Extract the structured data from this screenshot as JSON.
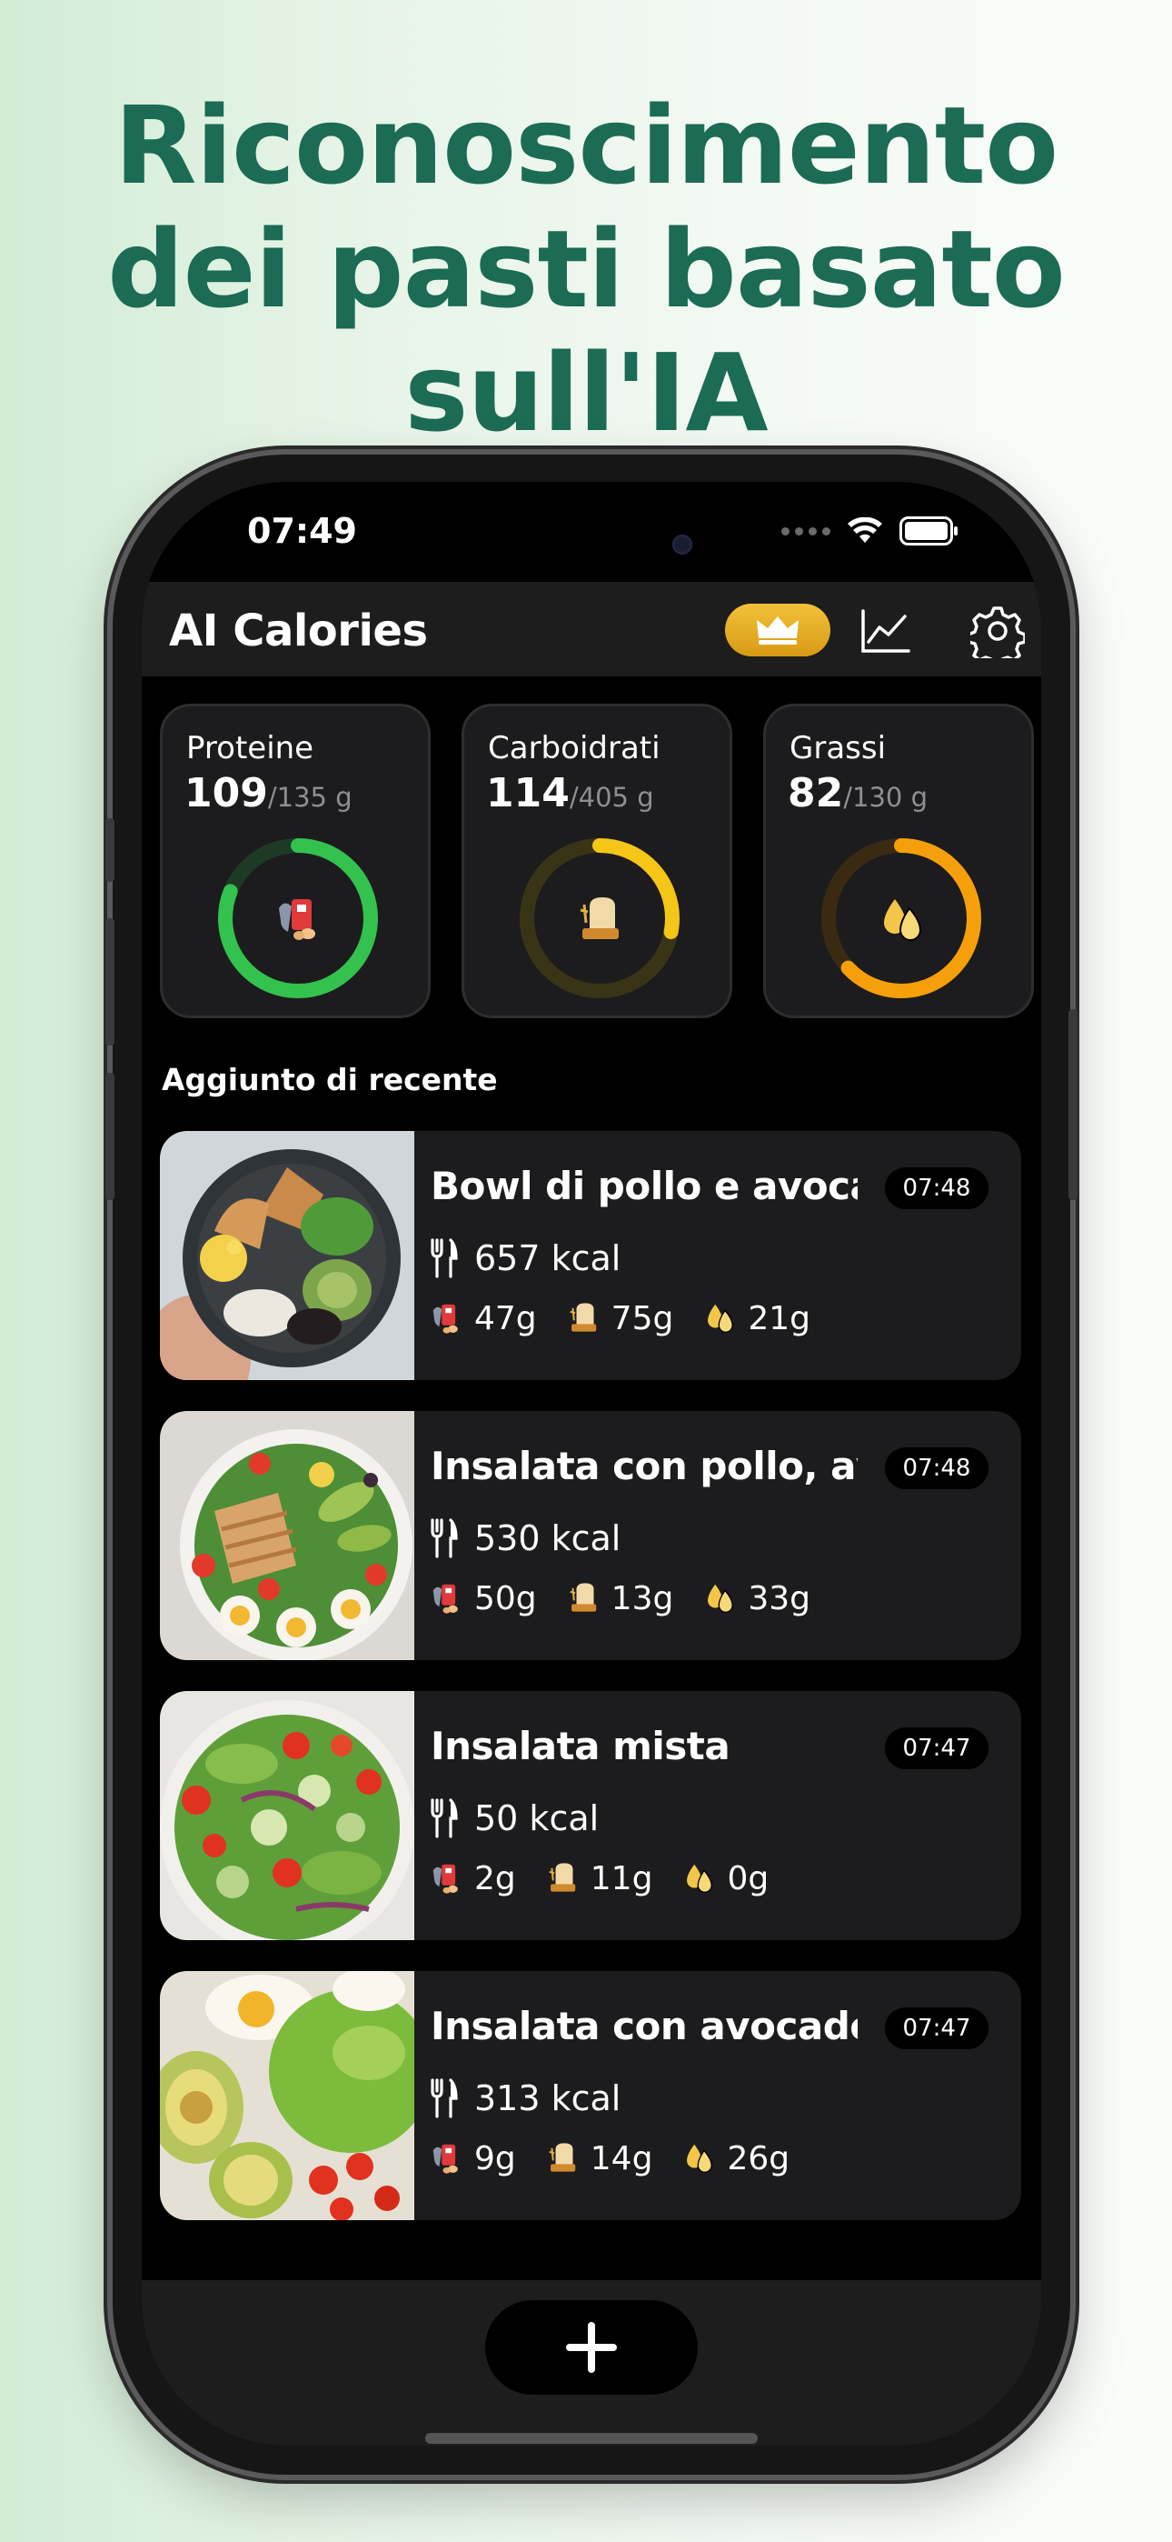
{
  "headline": {
    "line1": "Riconoscimento",
    "line2": "dei pasti basato",
    "line3": "sull'IA"
  },
  "status_bar": {
    "time": "07:49"
  },
  "header": {
    "title": "AI Calories"
  },
  "macros": [
    {
      "name": "Proteine",
      "value": "109",
      "goal": "/135 g",
      "progress": 0.81,
      "color": "#33c24d",
      "track": "#1e3a24"
    },
    {
      "name": "Carboidrati",
      "value": "114",
      "goal": "/405 g",
      "progress": 0.28,
      "color": "#f5c518",
      "track": "#3a3417"
    },
    {
      "name": "Grassi",
      "value": "82",
      "goal": "/130 g",
      "progress": 0.63,
      "color": "#f5a00a",
      "track": "#3a2a12"
    }
  ],
  "recent": {
    "title": "Aggiunto di recente",
    "meals": [
      {
        "name": "Bowl di pollo e avocado",
        "time": "07:48",
        "kcal": "657 kcal",
        "protein": "47g",
        "carbs": "75g",
        "fat": "21g"
      },
      {
        "name": "Insalata con pollo, avo...",
        "time": "07:48",
        "kcal": "530 kcal",
        "protein": "50g",
        "carbs": "13g",
        "fat": "33g"
      },
      {
        "name": "Insalata mista",
        "time": "07:47",
        "kcal": "50 kcal",
        "protein": "2g",
        "carbs": "11g",
        "fat": "0g"
      },
      {
        "name": "Insalata con avocado e...",
        "time": "07:47",
        "kcal": "313 kcal",
        "protein": "9g",
        "carbs": "14g",
        "fat": "26g"
      }
    ]
  }
}
